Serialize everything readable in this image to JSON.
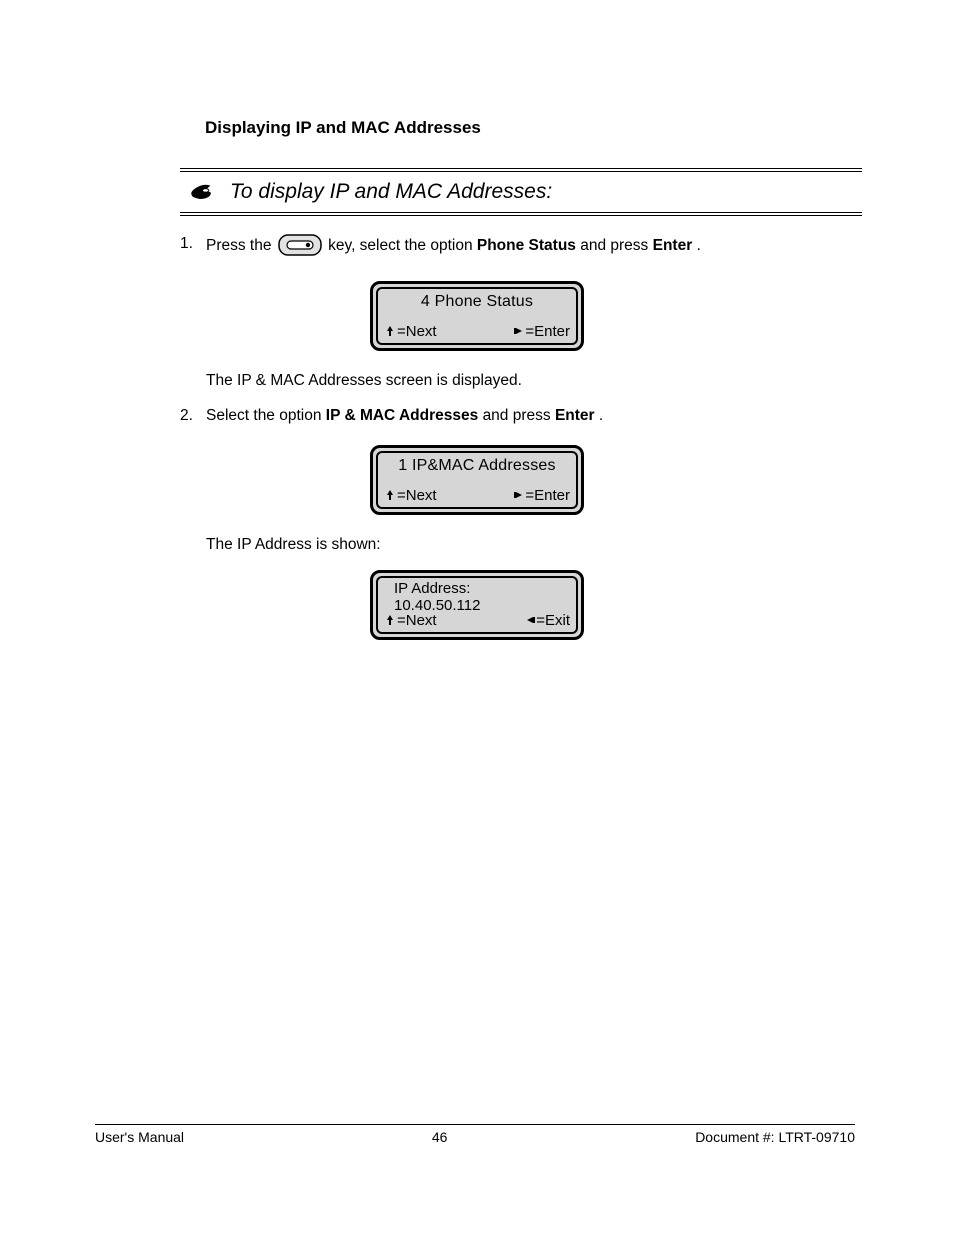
{
  "header": {
    "chapter_title": "Displaying IP and MAC Addresses",
    "section_title": "To display IP and MAC Addresses:"
  },
  "steps": {
    "s1": {
      "num": "1.",
      "pre": "Press the ",
      "post": " key, select the option ",
      "bold": "Phone Status",
      "tail": " and press ",
      "bold2": "Enter",
      "end": "."
    },
    "s2": {
      "num": "2.",
      "text_pre": "Select the option ",
      "bold": "IP & MAC Addresses",
      "text_mid": " and press ",
      "bold2": "Enter",
      "text_end": "."
    }
  },
  "intertext_1": "The IP & MAC Addresses screen is displayed.",
  "intertext_2": "The IP Address is shown:",
  "lcd1": {
    "title": "4   Phone Status",
    "left": "=Next",
    "right": "=Enter"
  },
  "lcd2": {
    "title": "1 IP&MAC Addresses",
    "left": "=Next",
    "right": "=Enter"
  },
  "lcd3": {
    "line1": "IP Address:",
    "line2": "10.40.50.112",
    "left": "=Next",
    "right": "=Exit"
  },
  "footer": {
    "left": "User's Manual",
    "center": "46",
    "right": "Document #: LTRT-09710"
  }
}
